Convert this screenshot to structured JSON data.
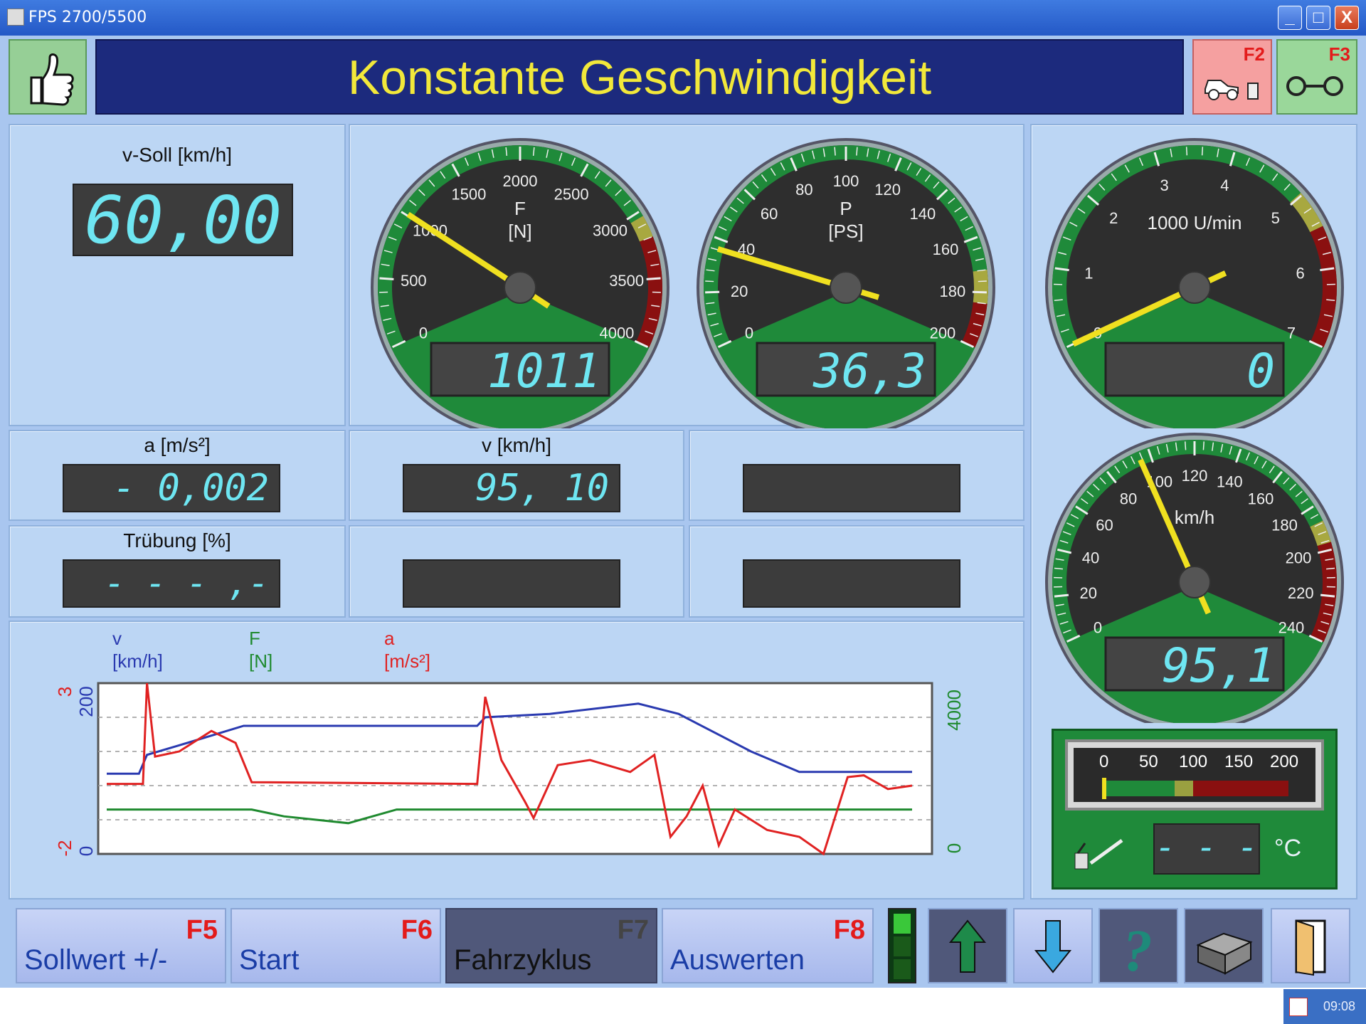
{
  "window": {
    "title": "FPS 2700/5500",
    "minimize": "_",
    "maximize": "□",
    "close": "X"
  },
  "header": {
    "title": "Konstante Geschwindigkeit",
    "f2_key": "F2",
    "f3_key": "F3",
    "thumbs_icon": "thumbs-up-icon",
    "f2_icon": "car-on-dyno-icon",
    "f3_icon": "dyno-rollers-icon"
  },
  "readouts": {
    "v_soll_label": "v-Soll [km/h]",
    "v_soll_value": "60,00",
    "a_label": "a [m/s²]",
    "a_value": "- 0,002",
    "v_label": "v [km/h]",
    "v_value": "95, 10",
    "truebung_label": "Trübung [%]",
    "truebung_value": "- - - ,-"
  },
  "gauges": {
    "force": {
      "label": "F",
      "unit": "[N]",
      "ticks": [
        "0",
        "500",
        "1000",
        "1500",
        "2000",
        "2500",
        "3000",
        "3500",
        "4000"
      ],
      "value": 1011,
      "display": "1011"
    },
    "power": {
      "label": "P",
      "unit": "[PS]",
      "ticks": [
        "0",
        "20",
        "40",
        "60",
        "80",
        "100",
        "120",
        "140",
        "160",
        "180",
        "200"
      ],
      "value": 36.3,
      "display": "36,3"
    },
    "rpm": {
      "label": "1000 U/min",
      "ticks": [
        "0",
        "1",
        "2",
        "3",
        "4",
        "5",
        "6",
        "7"
      ],
      "value": 0,
      "display": "0"
    },
    "speed": {
      "label": "km/h",
      "ticks": [
        "0",
        "20",
        "40",
        "60",
        "80",
        "100",
        "120",
        "140",
        "160",
        "180",
        "200",
        "220",
        "240"
      ],
      "value": 95.1,
      "display": "95,1"
    }
  },
  "temperature": {
    "ticks": [
      "0",
      "50",
      "100",
      "150",
      "200"
    ],
    "value_display": "- - -",
    "unit": "°C",
    "icon": "oil-thermometer-icon"
  },
  "chart_data": {
    "type": "line",
    "series": [
      {
        "name": "v",
        "unit": "[km/h]",
        "color": "#2a3ab0",
        "axis": "left-blue",
        "range": [
          0,
          200
        ]
      },
      {
        "name": "F",
        "unit": "[N]",
        "color": "#1f8a2f",
        "axis": "right",
        "range": [
          0,
          4000
        ]
      },
      {
        "name": "a",
        "unit": "[m/s²]",
        "color": "#e02222",
        "axis": "left-red",
        "range": [
          -2,
          3
        ]
      }
    ],
    "axis_labels": {
      "left_red_top": "3",
      "left_red_bottom": "-2",
      "left_blue_top": "200",
      "left_blue_bottom": "0",
      "right_top": "4000",
      "right_bottom": "0"
    },
    "grid": "horizontal-dashed"
  },
  "buttons": [
    {
      "label": "Sollwert +/-",
      "key": "F5"
    },
    {
      "label": "Start",
      "key": "F6"
    },
    {
      "label": "Fahrzyklus",
      "key": "F7"
    },
    {
      "label": "Auswerten",
      "key": "F8"
    }
  ],
  "toolbar_icons": [
    "up-arrow-icon",
    "down-arrow-icon",
    "help-icon",
    "printer-icon",
    "exit-door-icon"
  ],
  "tray": {
    "time": "09:08"
  },
  "colors": {
    "banner_bg": "#1c2a7d",
    "banner_text": "#f2e83a",
    "gauge_green": "#1f8a3a",
    "gauge_dial": "#2e2e2e",
    "needle": "#f0e020",
    "lcd_text": "#6ee6f2"
  }
}
